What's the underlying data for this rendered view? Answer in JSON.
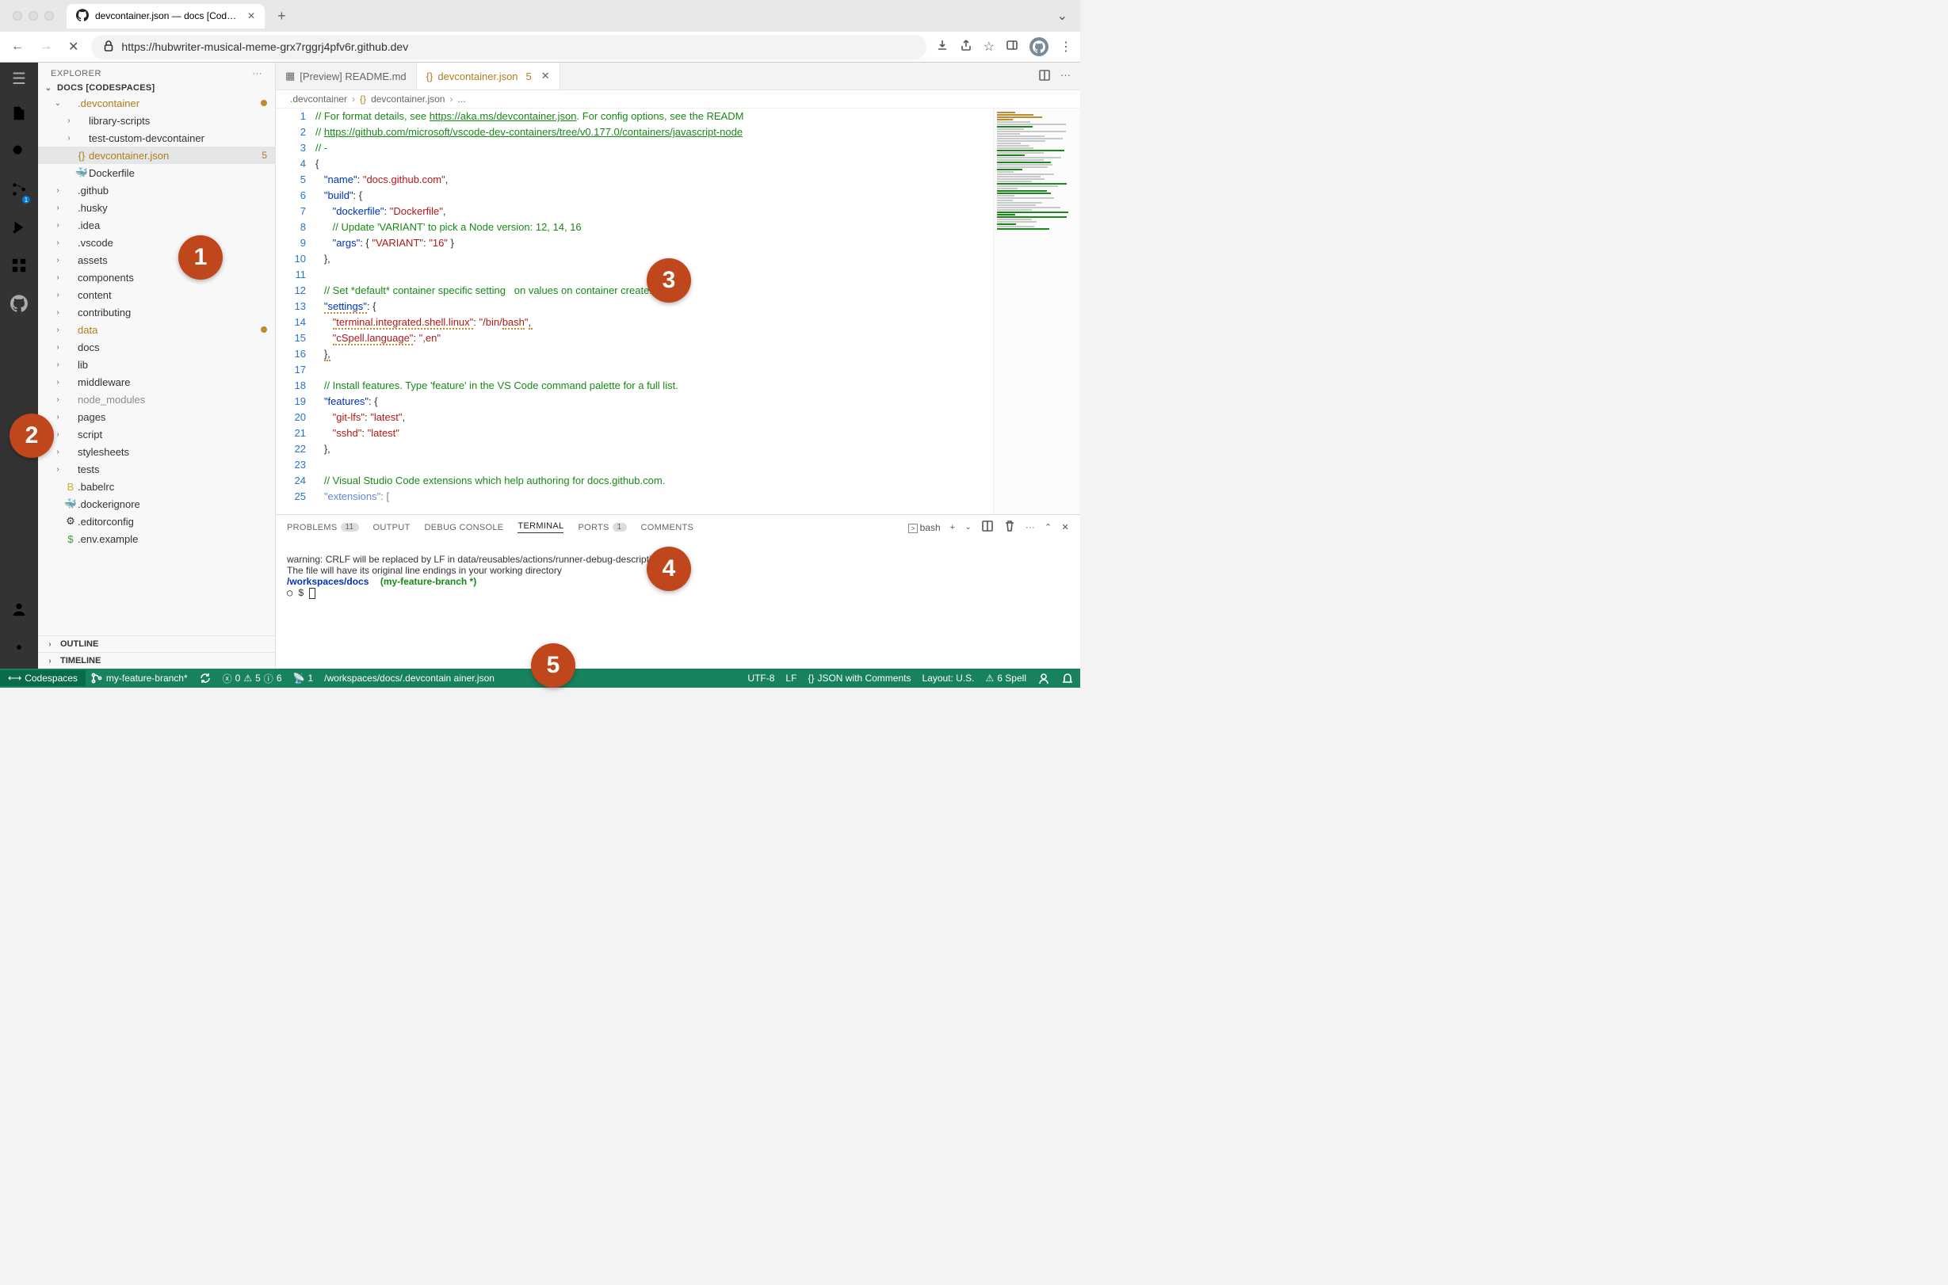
{
  "browser": {
    "tab_title": "devcontainer.json — docs [Cod…",
    "url": "https://hubwriter-musical-meme-grx7rggrj4pfv6r.github.dev"
  },
  "sidebar": {
    "title": "EXPLORER",
    "workspace": "DOCS [CODESPACES]",
    "tree": [
      {
        "name": ".devcontainer",
        "type": "folder",
        "depth": 1,
        "open": true,
        "modified": true,
        "amber": true
      },
      {
        "name": "library-scripts",
        "type": "folder",
        "depth": 2,
        "open": false
      },
      {
        "name": "test-custom-devcontainer",
        "type": "folder",
        "depth": 2,
        "open": false
      },
      {
        "name": "devcontainer.json",
        "type": "file",
        "depth": 2,
        "selected": true,
        "amber": true,
        "badge": "5",
        "icon": "{}"
      },
      {
        "name": "Dockerfile",
        "type": "file",
        "depth": 2,
        "icon": "🐳"
      },
      {
        "name": ".github",
        "type": "folder",
        "depth": 1
      },
      {
        "name": ".husky",
        "type": "folder",
        "depth": 1
      },
      {
        "name": ".idea",
        "type": "folder",
        "depth": 1
      },
      {
        "name": ".vscode",
        "type": "folder",
        "depth": 1
      },
      {
        "name": "assets",
        "type": "folder",
        "depth": 1
      },
      {
        "name": "components",
        "type": "folder",
        "depth": 1
      },
      {
        "name": "content",
        "type": "folder",
        "depth": 1
      },
      {
        "name": "contributing",
        "type": "folder",
        "depth": 1
      },
      {
        "name": "data",
        "type": "folder",
        "depth": 1,
        "modified": true,
        "amber": true
      },
      {
        "name": "docs",
        "type": "folder",
        "depth": 1
      },
      {
        "name": "lib",
        "type": "folder",
        "depth": 1
      },
      {
        "name": "middleware",
        "type": "folder",
        "depth": 1
      },
      {
        "name": "node_modules",
        "type": "folder",
        "depth": 1,
        "dim": true
      },
      {
        "name": "pages",
        "type": "folder",
        "depth": 1
      },
      {
        "name": "script",
        "type": "folder",
        "depth": 1
      },
      {
        "name": "stylesheets",
        "type": "folder",
        "depth": 1
      },
      {
        "name": "tests",
        "type": "folder",
        "depth": 1
      },
      {
        "name": ".babelrc",
        "type": "file",
        "depth": 1,
        "icon": "B",
        "iconColor": "#c9b22e"
      },
      {
        "name": ".dockerignore",
        "type": "file",
        "depth": 1,
        "icon": "🐳"
      },
      {
        "name": ".editorconfig",
        "type": "file",
        "depth": 1,
        "icon": "⚙"
      },
      {
        "name": ".env.example",
        "type": "file",
        "depth": 1,
        "icon": "$",
        "iconColor": "#3a9c3a"
      }
    ],
    "outline": "OUTLINE",
    "timeline": "TIMELINE"
  },
  "editor": {
    "tabs": [
      {
        "label": "[Preview] README.md",
        "icon": "▦",
        "active": false
      },
      {
        "label": "devcontainer.json",
        "icon": "{}",
        "active": true,
        "badge": "5"
      }
    ],
    "breadcrumb": [
      ".devcontainer",
      "devcontainer.json",
      "..."
    ],
    "lines": [
      {
        "n": 1,
        "html": "<span class='cm-comment'>// For format details, see <span class='cm-link'>https://aka.ms/devcontainer.json</span>. For config options, see the READM</span>"
      },
      {
        "n": 2,
        "html": "<span class='cm-comment'>// <span class='cm-link'>https://github.com/microsoft/vscode-dev-containers/tree/v0.177.0/containers/javascript-node</span></span>"
      },
      {
        "n": 3,
        "html": "<span class='cm-comment'>// -</span>"
      },
      {
        "n": 4,
        "html": "<span class='cm-punc'>{</span>"
      },
      {
        "n": 5,
        "html": "   <span class='cm-key'>\"name\"</span>: <span class='cm-str'>\"docs.github.com\"</span>,"
      },
      {
        "n": 6,
        "html": "   <span class='cm-key'>\"build\"</span>: {"
      },
      {
        "n": 7,
        "html": "      <span class='cm-key'>\"dockerfile\"</span>: <span class='cm-str'>\"Dockerfile\"</span>,"
      },
      {
        "n": 8,
        "html": "      <span class='cm-comment'>// Update 'VARIANT' to pick a Node version: 12, 14, 16</span>"
      },
      {
        "n": 9,
        "html": "      <span class='cm-key'>\"args\"</span>: { <span class='cm-str'>\"VARIANT\"</span>: <span class='cm-str'>\"16\"</span> }"
      },
      {
        "n": 10,
        "html": "   },"
      },
      {
        "n": 11,
        "html": ""
      },
      {
        "n": 12,
        "html": "   <span class='cm-comment'>// Set *default* container specific setting   on values on container create.</span>"
      },
      {
        "n": 13,
        "html": "   <span class='cm-key squiggle'>\"settings\"</span>: {"
      },
      {
        "n": 14,
        "html": "      <span class='cm-str squiggle'>\"terminal.integrated.shell.linux\"</span>: <span class='cm-str'>\"/bin/<span class='squiggle'>bash</span>\"</span><span class='squiggle'>,</span>"
      },
      {
        "n": 15,
        "html": "      <span class='cm-str squiggle'>\"cSpell.language\"</span>: <span class='cm-str'>\",en\"</span>"
      },
      {
        "n": 16,
        "html": "   <span class='squiggle'>},</span>"
      },
      {
        "n": 17,
        "html": ""
      },
      {
        "n": 18,
        "html": "   <span class='cm-comment'>// Install features. Type 'feature' in the VS Code command palette for a full list.</span>"
      },
      {
        "n": 19,
        "html": "   <span class='cm-key'>\"features\"</span>: {"
      },
      {
        "n": 20,
        "html": "      <span class='cm-str'>\"git-lfs\"</span>: <span class='cm-str'>\"latest\"</span>,"
      },
      {
        "n": 21,
        "html": "      <span class='cm-str'>\"sshd\"</span>: <span class='cm-str'>\"latest\"</span>"
      },
      {
        "n": 22,
        "html": "   },"
      },
      {
        "n": 23,
        "html": ""
      },
      {
        "n": 24,
        "html": "   <span class='cm-comment'>// Visual Studio Code extensions which help authoring for docs.github.com.</span>"
      },
      {
        "n": 25,
        "html": "   <span class='cm-key' style='opacity:.6'>\"extensions\"</span><span style='opacity:.6'>: [</span>"
      }
    ]
  },
  "panel": {
    "tabs": {
      "problems": "PROBLEMS",
      "problems_count": "11",
      "output": "OUTPUT",
      "debug": "DEBUG CONSOLE",
      "terminal": "TERMINAL",
      "ports": "PORTS",
      "ports_count": "1",
      "comments": "COMMENTS"
    },
    "shell_name": "bash",
    "terminal": {
      "line1": "warning: CRLF will be replaced by LF in data/reusables/actions/runner-debug-description.md.",
      "line2": "The file will have its original line endings in your working directory",
      "prompt_path": "/workspaces/docs",
      "prompt_branch": "(my-feature-branch *)",
      "prompt_sym": "$"
    }
  },
  "status": {
    "codespaces": "Codespaces",
    "branch": "my-feature-branch*",
    "errors": "0",
    "warnings": "5",
    "info": "6",
    "ports": "1",
    "path": "/workspaces/docs/.devcontain          ainer.json",
    "encoding": "UTF-8",
    "eol": "LF",
    "lang": "JSON with Comments",
    "layout": "Layout: U.S.",
    "spell": "6 Spell"
  },
  "annotations": [
    "1",
    "2",
    "3",
    "4",
    "5"
  ]
}
